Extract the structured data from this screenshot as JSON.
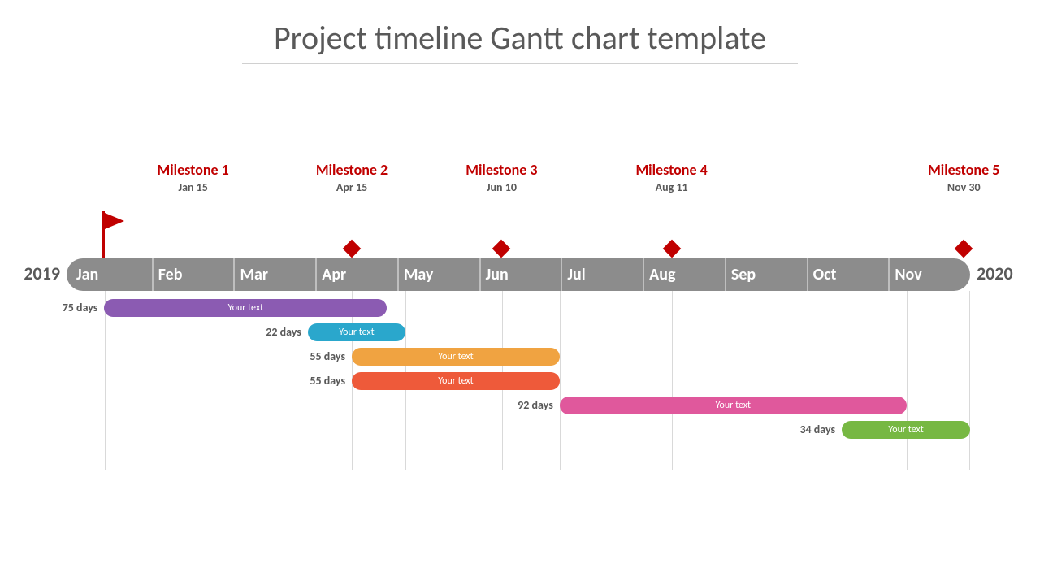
{
  "title": "Project timeline Gantt chart template",
  "axis": {
    "year_start": "2019",
    "year_end": "2020",
    "months": [
      "Jan",
      "Feb",
      "Mar",
      "Apr",
      "May",
      "Jun",
      "Jul",
      "Aug",
      "Sep",
      "Oct",
      "Nov"
    ]
  },
  "milestones": [
    {
      "name": "Milestone 1",
      "date": "Jan 15",
      "pct": 4.17,
      "marker": "flag"
    },
    {
      "name": "Milestone 2",
      "date": "Apr 15",
      "pct": 31.57,
      "marker": "diamond"
    },
    {
      "name": "Milestone 3",
      "date": "Jun 10",
      "pct": 48.15,
      "marker": "diamond"
    },
    {
      "name": "Milestone 4",
      "date": "Aug 11",
      "pct": 66.96,
      "marker": "diamond"
    },
    {
      "name": "Milestone 5",
      "date": "Nov 30",
      "pct": 100.0,
      "marker": "diamond"
    }
  ],
  "tasks": [
    {
      "duration": "75 days",
      "label": "Your text",
      "start_pct": 4.17,
      "width_pct": 31.3,
      "color": "#8b5bb2",
      "row": 0
    },
    {
      "duration": "22 days",
      "label": "Your text",
      "start_pct": 26.7,
      "width_pct": 10.8,
      "color": "#2aa7cc",
      "row": 1
    },
    {
      "duration": "55 days",
      "label": "Your text",
      "start_pct": 31.57,
      "width_pct": 23.0,
      "color": "#f0a341",
      "row": 2
    },
    {
      "duration": "55 days",
      "label": "Your text",
      "start_pct": 31.57,
      "width_pct": 23.0,
      "color": "#ee5a3a",
      "row": 3
    },
    {
      "duration": "92 days",
      "label": "Your text",
      "start_pct": 54.57,
      "width_pct": 38.4,
      "color": "#e0589c",
      "row": 4
    },
    {
      "duration": "34 days",
      "label": "Your text",
      "start_pct": 85.8,
      "width_pct": 14.2,
      "color": "#77b843",
      "row": 5
    }
  ],
  "chart_data": {
    "type": "bar",
    "title": "Project timeline Gantt chart template",
    "xlabel": "2019 → 2020",
    "ylabel": "",
    "categories": [
      "Jan",
      "Feb",
      "Mar",
      "Apr",
      "May",
      "Jun",
      "Jul",
      "Aug",
      "Sep",
      "Oct",
      "Nov"
    ],
    "milestones": [
      {
        "name": "Milestone 1",
        "date": "Jan 15"
      },
      {
        "name": "Milestone 2",
        "date": "Apr 15"
      },
      {
        "name": "Milestone 3",
        "date": "Jun 10"
      },
      {
        "name": "Milestone 4",
        "date": "Aug 11"
      },
      {
        "name": "Milestone 5",
        "date": "Nov 30"
      }
    ],
    "series": [
      {
        "name": "Your text",
        "start": "Jan 15",
        "duration_days": 75
      },
      {
        "name": "Your text",
        "start": "Mar 28",
        "duration_days": 22
      },
      {
        "name": "Your text",
        "start": "Apr 15",
        "duration_days": 55
      },
      {
        "name": "Your text",
        "start": "Apr 15",
        "duration_days": 55
      },
      {
        "name": "Your text",
        "start": "Jun 30",
        "duration_days": 92
      },
      {
        "name": "Your text",
        "start": "Oct 27",
        "duration_days": 34
      }
    ]
  }
}
